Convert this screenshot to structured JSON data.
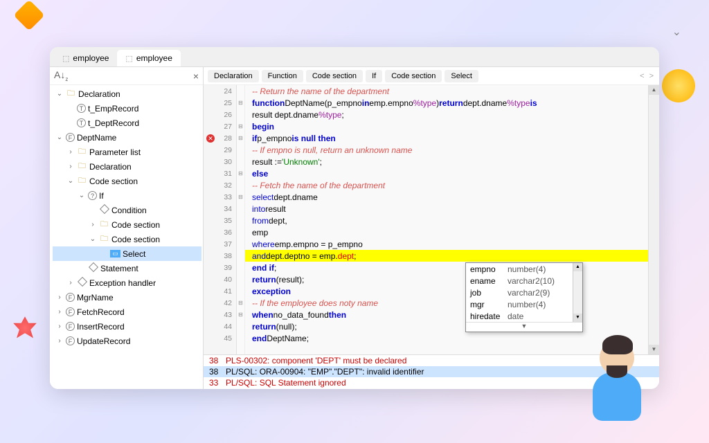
{
  "tabs": [
    {
      "label": "employee",
      "active": false,
      "icon": "cube"
    },
    {
      "label": "employee",
      "active": true,
      "icon": "cube-bold"
    }
  ],
  "breadcrumb": [
    "Declaration",
    "Function",
    "Code section",
    "If",
    "Code section",
    "Select"
  ],
  "outline": [
    {
      "depth": 0,
      "tw": "v",
      "icon": "folder",
      "label": "Declaration"
    },
    {
      "depth": 1,
      "tw": "",
      "icon": "T",
      "label": "t_EmpRecord"
    },
    {
      "depth": 1,
      "tw": "",
      "icon": "T",
      "label": "t_DeptRecord"
    },
    {
      "depth": 0,
      "tw": "v",
      "icon": "F",
      "label": "DeptName"
    },
    {
      "depth": 1,
      "tw": ">",
      "icon": "folder",
      "label": "Parameter list"
    },
    {
      "depth": 1,
      "tw": ">",
      "icon": "folder",
      "label": "Declaration"
    },
    {
      "depth": 1,
      "tw": "v",
      "icon": "folder",
      "label": "Code section"
    },
    {
      "depth": 2,
      "tw": "v",
      "icon": "?",
      "label": "If"
    },
    {
      "depth": 3,
      "tw": "",
      "icon": "diamond",
      "label": "Condition"
    },
    {
      "depth": 3,
      "tw": ">",
      "icon": "folder",
      "label": "Code section"
    },
    {
      "depth": 3,
      "tw": "v",
      "icon": "folder",
      "label": "Code section"
    },
    {
      "depth": 4,
      "tw": "",
      "icon": "sel",
      "label": "Select",
      "selected": true
    },
    {
      "depth": 2,
      "tw": "",
      "icon": "diamond",
      "label": "Statement"
    },
    {
      "depth": 1,
      "tw": ">",
      "icon": "diamond",
      "label": "Exception handler"
    },
    {
      "depth": 0,
      "tw": ">",
      "icon": "F",
      "label": "MgrName"
    },
    {
      "depth": 0,
      "tw": ">",
      "icon": "F",
      "label": "FetchRecord"
    },
    {
      "depth": 0,
      "tw": ">",
      "icon": "F",
      "label": "InsertRecord"
    },
    {
      "depth": 0,
      "tw": ">",
      "icon": "F",
      "label": "UpdateRecord"
    }
  ],
  "code": [
    {
      "n": 24,
      "fold": "",
      "html": "    <span class='cm'>-- Return the name of the department</span>"
    },
    {
      "n": 25,
      "fold": "⊟",
      "html": "    <span class='kw'>function</span> <span class='fn'>DeptName(p_empno</span> <span class='kw'>in</span> <span class='fn'>emp.empno</span><span class='ty'>%type</span><span class='fn'>)</span> <span class='kw'>return</span> <span class='fn'>dept.dname</span><span class='ty'>%type</span> <span class='kw'>is</span>"
    },
    {
      "n": 26,
      "fold": "",
      "html": "      <span class='fn'>result dept.dname</span><span class='ty'>%type</span>;"
    },
    {
      "n": 27,
      "fold": "⊟",
      "html": "    <span class='kw'>begin</span>"
    },
    {
      "n": 28,
      "fold": "⊟",
      "err": true,
      "html": "      <span class='kw'>if</span> <span class='fn'>p_empno</span> <span class='kw'>is null then</span>"
    },
    {
      "n": 29,
      "fold": "",
      "html": "        <span class='cm'>-- If empno is null, return an unknown name</span>"
    },
    {
      "n": 30,
      "fold": "",
      "html": "        <span class='fn'>result :=</span> <span class='str'>'Unknown'</span>;"
    },
    {
      "n": 31,
      "fold": "⊟",
      "html": "      <span class='kw'>else</span>"
    },
    {
      "n": 32,
      "fold": "",
      "html": "        <span class='cm'>-- Fetch the name of the department</span>"
    },
    {
      "n": 33,
      "fold": "⊟",
      "html": "        <span class='kw2'>select</span> <span class='fn'>dept.dname</span>"
    },
    {
      "n": 34,
      "fold": "",
      "html": "          <span class='kw2'>into</span> <span class='fn'>result</span>"
    },
    {
      "n": 35,
      "fold": "",
      "html": "          <span class='kw2'>from</span> <span class='fn'>dept,</span>"
    },
    {
      "n": 36,
      "fold": "",
      "html": "               <span class='fn'>emp</span>"
    },
    {
      "n": 37,
      "fold": "",
      "html": "         <span class='kw2'>where</span> <span class='fn'>emp.empno = p_empno</span>"
    },
    {
      "n": 38,
      "fold": "",
      "hl": true,
      "html": "           <span class='kw2'>and</span> <span class='fn'>dept.deptno = emp.</span><span class='op'>dept</span>;"
    },
    {
      "n": 39,
      "fold": "",
      "html": "      <span class='kw'>end if</span>;"
    },
    {
      "n": 40,
      "fold": "",
      "html": "      <span class='kw'>return</span><span class='fn'>(result);</span>"
    },
    {
      "n": 41,
      "fold": "",
      "html": "    <span class='kw'>exception</span>"
    },
    {
      "n": 42,
      "fold": "⊟",
      "html": "      <span class='cm'>-- If the employee does not</span>                          <span class='cm'>y name</span>"
    },
    {
      "n": 43,
      "fold": "⊟",
      "html": "      <span class='kw'>when</span> <span class='fn'>no_data_found</span> <span class='kw'>then</span>"
    },
    {
      "n": 44,
      "fold": "",
      "html": "        <span class='kw'>return</span><span class='fn'>(null);</span>"
    },
    {
      "n": 45,
      "fold": "",
      "html": "    <span class='kw'>end</span> <span class='fn'>DeptName;</span>"
    }
  ],
  "autocomplete": [
    {
      "name": "empno",
      "type": "number(4)"
    },
    {
      "name": "ename",
      "type": "varchar2(10)"
    },
    {
      "name": "job",
      "type": "varchar2(9)"
    },
    {
      "name": "mgr",
      "type": "number(4)"
    },
    {
      "name": "hiredate",
      "type": "date"
    }
  ],
  "errors": [
    {
      "line": "38",
      "msg": "PLS-00302: component 'DEPT' must be declared",
      "sel": false
    },
    {
      "line": "38",
      "msg": "PL/SQL: ORA-00904: \"EMP\".\"DEPT\": invalid identifier",
      "sel": true
    },
    {
      "line": "33",
      "msg": "PL/SQL: SQL Statement ignored",
      "sel": false
    }
  ]
}
